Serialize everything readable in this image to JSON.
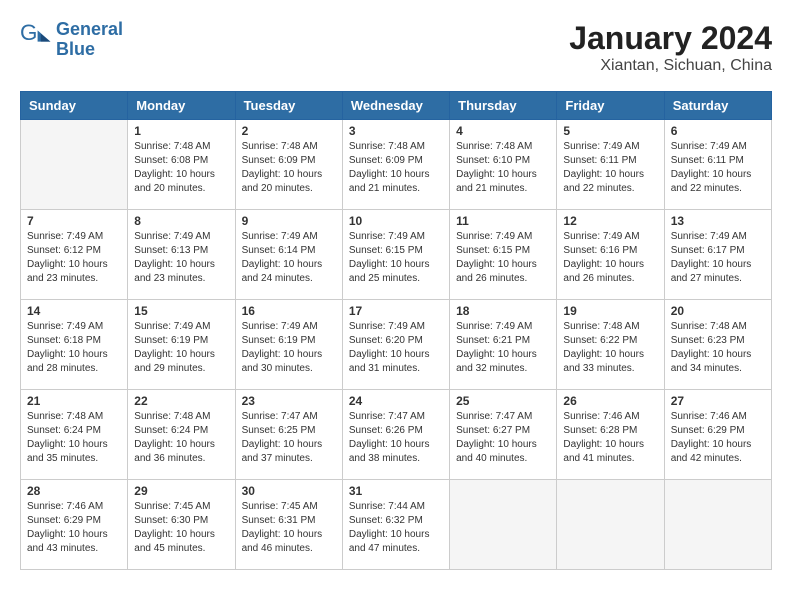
{
  "logo": {
    "line1": "General",
    "line2": "Blue"
  },
  "title": "January 2024",
  "subtitle": "Xiantan, Sichuan, China",
  "days_of_week": [
    "Sunday",
    "Monday",
    "Tuesday",
    "Wednesday",
    "Thursday",
    "Friday",
    "Saturday"
  ],
  "weeks": [
    [
      {
        "day": "",
        "info": ""
      },
      {
        "day": "1",
        "info": "Sunrise: 7:48 AM\nSunset: 6:08 PM\nDaylight: 10 hours\nand 20 minutes."
      },
      {
        "day": "2",
        "info": "Sunrise: 7:48 AM\nSunset: 6:09 PM\nDaylight: 10 hours\nand 20 minutes."
      },
      {
        "day": "3",
        "info": "Sunrise: 7:48 AM\nSunset: 6:09 PM\nDaylight: 10 hours\nand 21 minutes."
      },
      {
        "day": "4",
        "info": "Sunrise: 7:48 AM\nSunset: 6:10 PM\nDaylight: 10 hours\nand 21 minutes."
      },
      {
        "day": "5",
        "info": "Sunrise: 7:49 AM\nSunset: 6:11 PM\nDaylight: 10 hours\nand 22 minutes."
      },
      {
        "day": "6",
        "info": "Sunrise: 7:49 AM\nSunset: 6:11 PM\nDaylight: 10 hours\nand 22 minutes."
      }
    ],
    [
      {
        "day": "7",
        "info": "Sunrise: 7:49 AM\nSunset: 6:12 PM\nDaylight: 10 hours\nand 23 minutes."
      },
      {
        "day": "8",
        "info": "Sunrise: 7:49 AM\nSunset: 6:13 PM\nDaylight: 10 hours\nand 23 minutes."
      },
      {
        "day": "9",
        "info": "Sunrise: 7:49 AM\nSunset: 6:14 PM\nDaylight: 10 hours\nand 24 minutes."
      },
      {
        "day": "10",
        "info": "Sunrise: 7:49 AM\nSunset: 6:15 PM\nDaylight: 10 hours\nand 25 minutes."
      },
      {
        "day": "11",
        "info": "Sunrise: 7:49 AM\nSunset: 6:15 PM\nDaylight: 10 hours\nand 26 minutes."
      },
      {
        "day": "12",
        "info": "Sunrise: 7:49 AM\nSunset: 6:16 PM\nDaylight: 10 hours\nand 26 minutes."
      },
      {
        "day": "13",
        "info": "Sunrise: 7:49 AM\nSunset: 6:17 PM\nDaylight: 10 hours\nand 27 minutes."
      }
    ],
    [
      {
        "day": "14",
        "info": "Sunrise: 7:49 AM\nSunset: 6:18 PM\nDaylight: 10 hours\nand 28 minutes."
      },
      {
        "day": "15",
        "info": "Sunrise: 7:49 AM\nSunset: 6:19 PM\nDaylight: 10 hours\nand 29 minutes."
      },
      {
        "day": "16",
        "info": "Sunrise: 7:49 AM\nSunset: 6:19 PM\nDaylight: 10 hours\nand 30 minutes."
      },
      {
        "day": "17",
        "info": "Sunrise: 7:49 AM\nSunset: 6:20 PM\nDaylight: 10 hours\nand 31 minutes."
      },
      {
        "day": "18",
        "info": "Sunrise: 7:49 AM\nSunset: 6:21 PM\nDaylight: 10 hours\nand 32 minutes."
      },
      {
        "day": "19",
        "info": "Sunrise: 7:48 AM\nSunset: 6:22 PM\nDaylight: 10 hours\nand 33 minutes."
      },
      {
        "day": "20",
        "info": "Sunrise: 7:48 AM\nSunset: 6:23 PM\nDaylight: 10 hours\nand 34 minutes."
      }
    ],
    [
      {
        "day": "21",
        "info": "Sunrise: 7:48 AM\nSunset: 6:24 PM\nDaylight: 10 hours\nand 35 minutes."
      },
      {
        "day": "22",
        "info": "Sunrise: 7:48 AM\nSunset: 6:24 PM\nDaylight: 10 hours\nand 36 minutes."
      },
      {
        "day": "23",
        "info": "Sunrise: 7:47 AM\nSunset: 6:25 PM\nDaylight: 10 hours\nand 37 minutes."
      },
      {
        "day": "24",
        "info": "Sunrise: 7:47 AM\nSunset: 6:26 PM\nDaylight: 10 hours\nand 38 minutes."
      },
      {
        "day": "25",
        "info": "Sunrise: 7:47 AM\nSunset: 6:27 PM\nDaylight: 10 hours\nand 40 minutes."
      },
      {
        "day": "26",
        "info": "Sunrise: 7:46 AM\nSunset: 6:28 PM\nDaylight: 10 hours\nand 41 minutes."
      },
      {
        "day": "27",
        "info": "Sunrise: 7:46 AM\nSunset: 6:29 PM\nDaylight: 10 hours\nand 42 minutes."
      }
    ],
    [
      {
        "day": "28",
        "info": "Sunrise: 7:46 AM\nSunset: 6:29 PM\nDaylight: 10 hours\nand 43 minutes."
      },
      {
        "day": "29",
        "info": "Sunrise: 7:45 AM\nSunset: 6:30 PM\nDaylight: 10 hours\nand 45 minutes."
      },
      {
        "day": "30",
        "info": "Sunrise: 7:45 AM\nSunset: 6:31 PM\nDaylight: 10 hours\nand 46 minutes."
      },
      {
        "day": "31",
        "info": "Sunrise: 7:44 AM\nSunset: 6:32 PM\nDaylight: 10 hours\nand 47 minutes."
      },
      {
        "day": "",
        "info": ""
      },
      {
        "day": "",
        "info": ""
      },
      {
        "day": "",
        "info": ""
      }
    ]
  ]
}
